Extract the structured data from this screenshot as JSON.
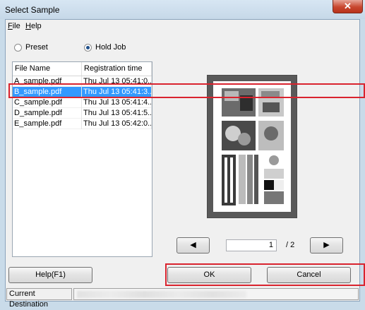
{
  "window": {
    "title": "Select Sample",
    "close_glyph": "✕"
  },
  "menu": [
    {
      "label": "File",
      "accel": "F",
      "rest": "ile"
    },
    {
      "label": "Help",
      "accel": "H",
      "rest": "elp"
    }
  ],
  "source_options": [
    {
      "label": "Preset",
      "checked": false
    },
    {
      "label": "Hold Job",
      "checked": true
    }
  ],
  "file_list": {
    "columns": [
      "File Name",
      "Registration time"
    ],
    "rows": [
      {
        "name": "A_sample.pdf",
        "time": "Thu Jul 13 05:41:0...",
        "selected": false
      },
      {
        "name": "B_sample.pdf",
        "time": "Thu Jul 13 05:41:3...",
        "selected": true
      },
      {
        "name": "C_sample.pdf",
        "time": "Thu Jul 13 05:41:4...",
        "selected": false
      },
      {
        "name": "D_sample.pdf",
        "time": "Thu Jul 13 05:41:5...",
        "selected": false
      },
      {
        "name": "E_sample.pdf",
        "time": "Thu Jul 13 05:42:0...",
        "selected": false
      }
    ]
  },
  "pager": {
    "prev_glyph": "◀",
    "next_glyph": "▶",
    "current_page": "1",
    "total_pages": "/ 2"
  },
  "buttons": {
    "help": "Help(F1)",
    "ok": "OK",
    "cancel": "Cancel"
  },
  "status": {
    "label": "Current Destination",
    "value": ""
  },
  "colors": {
    "selection": "#3399ff",
    "highlight": "#d9232e",
    "window_frame": "#c9dbe9"
  }
}
